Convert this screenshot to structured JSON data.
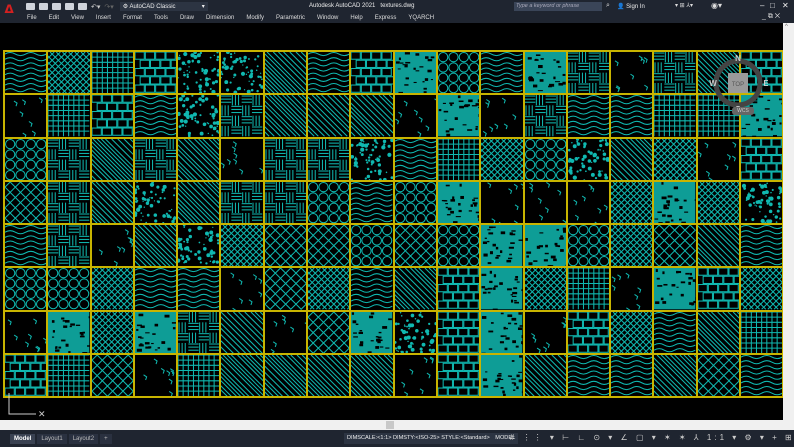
{
  "app": {
    "title": "Autodesk AutoCAD 2021",
    "file": "textures.dwg",
    "logo": "A"
  },
  "quick_access": {
    "workspace": "AutoCAD Classic",
    "icons": [
      "new-icon",
      "open-icon",
      "save-icon",
      "saveas-icon",
      "print-icon",
      "undo-icon",
      "redo-icon"
    ]
  },
  "search": {
    "placeholder": "Type a keyword or phrase"
  },
  "account": {
    "sign_in": "Sign In"
  },
  "menu": [
    "File",
    "Edit",
    "View",
    "Insert",
    "Format",
    "Tools",
    "Draw",
    "Dimension",
    "Modify",
    "Parametric",
    "Window",
    "Help",
    "Express",
    "YQARCH"
  ],
  "viewcube": {
    "n": "N",
    "s": "S",
    "e": "E",
    "w": "W",
    "top": "TOP",
    "wcs": "WCS"
  },
  "grid": {
    "rows": 8,
    "cols": 18,
    "cell_color": "#10b8b0",
    "border_color": "#c8b400"
  },
  "layout_tabs": [
    "Model",
    "Layout1",
    "Layout2",
    "+"
  ],
  "status": {
    "text": "DIMSCALE:<1:1> DIMSTY:<ISO-25> STYLE:<Standard>",
    "mode": "MODEL",
    "icons": "# ⋮⋮ ▾ ⊢ ∟ ⊙ ▾ ∠ ▢ ▾ ✶ ✶ ⅄ 1:1 ▾ ⚙ ▾ + ⊞ ⊡ ☰"
  }
}
